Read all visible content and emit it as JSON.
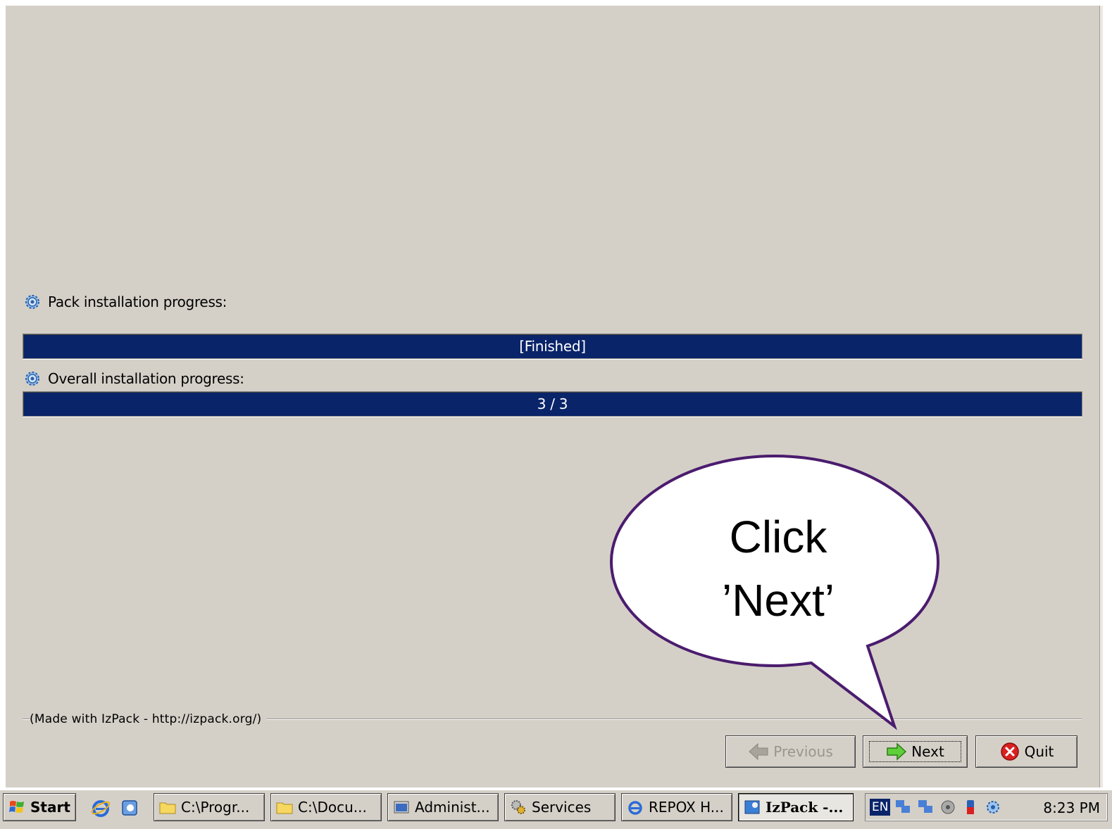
{
  "installer": {
    "pack_label": "Pack installation progress:",
    "pack_progress_text": "[Finished]",
    "pack_progress": 1.0,
    "overall_label": "Overall installation progress:",
    "overall_progress_text": "3 / 3",
    "overall_progress": 1.0,
    "made_with": "(Made with IzPack - http://izpack.org/)"
  },
  "buttons": {
    "previous": "Previous",
    "next": "Next",
    "quit": "Quit"
  },
  "callout": {
    "line1": "Click",
    "line2": "’Next’"
  },
  "taskbar": {
    "start": "Start",
    "items": [
      {
        "label": "C:\\Progr..."
      },
      {
        "label": "C:\\Docu..."
      },
      {
        "label": "Administ..."
      },
      {
        "label": "Services"
      },
      {
        "label": "REPOX H..."
      },
      {
        "label": "IzPack -..."
      }
    ],
    "lang": "EN",
    "clock": "8:23 PM"
  },
  "colors": {
    "progress_fill": "#0a246a",
    "window_bg": "#d4d0c8",
    "callout_border": "#4b1c6e"
  }
}
